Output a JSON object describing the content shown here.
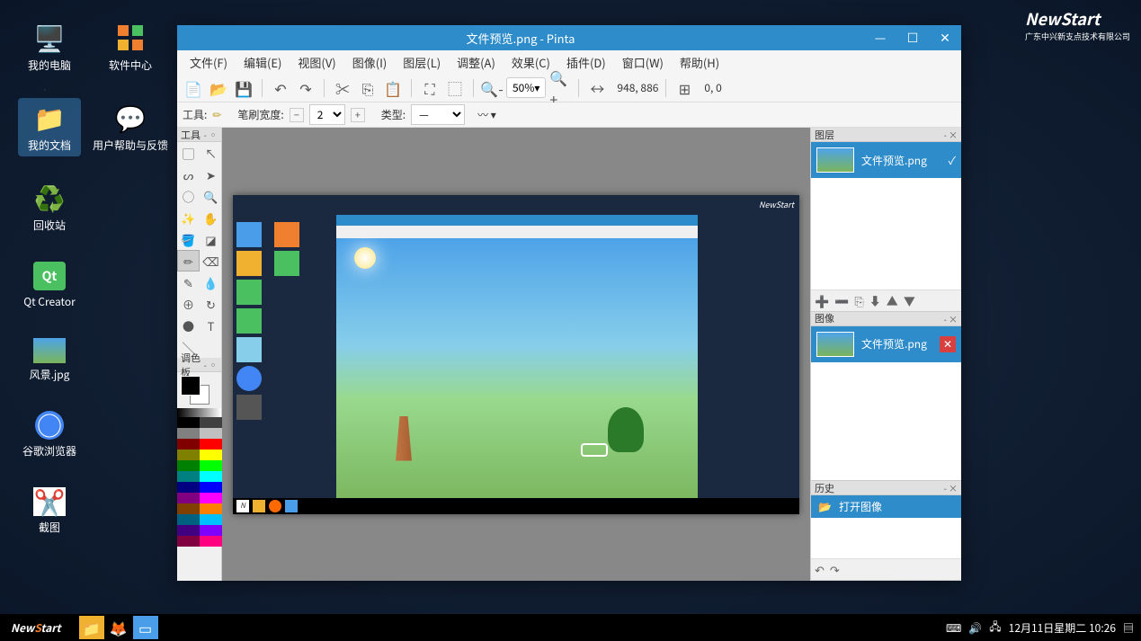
{
  "brand": {
    "name": "NewStart",
    "sub": "广东中兴新支点技术有限公司"
  },
  "desktop_icons_col1": [
    {
      "label": "我的电脑",
      "icon": "🖥️",
      "color": "#4a9de8"
    },
    {
      "label": "我的文档",
      "icon": "📁",
      "color": "#f0b030",
      "selected": true
    },
    {
      "label": "回收站",
      "icon": "♻️",
      "color": "#4ac060"
    },
    {
      "label": "Qt Creator",
      "icon": "Qt",
      "color": "#4ac060"
    },
    {
      "label": "风景.jpg",
      "icon": "🖼️",
      "color": "#87ceeb"
    },
    {
      "label": "谷歌浏览器",
      "icon": "○",
      "color": "#4285f4"
    },
    {
      "label": "截图",
      "icon": "✂️",
      "color": "#fff"
    }
  ],
  "desktop_icons_col2": [
    {
      "label": "软件中心",
      "icon": "⊞",
      "color": "#f08030"
    },
    {
      "label": "用户帮助与反馈",
      "icon": "💬",
      "color": "#4ac060"
    }
  ],
  "window": {
    "title": "文件预览.png - Pinta",
    "menus": [
      "文件(F)",
      "编辑(E)",
      "视图(V)",
      "图像(I)",
      "图层(L)",
      "调整(A)",
      "效果(C)",
      "插件(D)",
      "窗口(W)",
      "帮助(H)"
    ]
  },
  "toolbar": {
    "zoom": "50%",
    "coords": "948, 886",
    "pos": "0, 0"
  },
  "tool_opts": {
    "tools_label": "工具:",
    "brush_width_label": "笔刷宽度:",
    "brush_width": "2",
    "type_label": "类型:"
  },
  "panel_titles": {
    "tools": "工具",
    "palette": "调色板",
    "layers": "图层",
    "images": "图像",
    "history": "历史"
  },
  "layers": [
    {
      "name": "文件预览.png"
    }
  ],
  "images": [
    {
      "name": "文件预览.png"
    }
  ],
  "history": [
    {
      "name": "打开图像",
      "icon": "📂"
    }
  ],
  "palette_colors": [
    "#000",
    "#404040",
    "#808080",
    "#c0c0c0",
    "#800000",
    "#ff0000",
    "#808000",
    "#ffff00",
    "#008000",
    "#00ff00",
    "#008080",
    "#00ffff",
    "#000080",
    "#0000ff",
    "#800080",
    "#ff00ff",
    "#804000",
    "#ff8000",
    "#006080",
    "#00c0ff",
    "#400080",
    "#8000ff",
    "#800040",
    "#ff0080"
  ],
  "taskbar": {
    "clock": "12月11日星期二 10:26"
  }
}
